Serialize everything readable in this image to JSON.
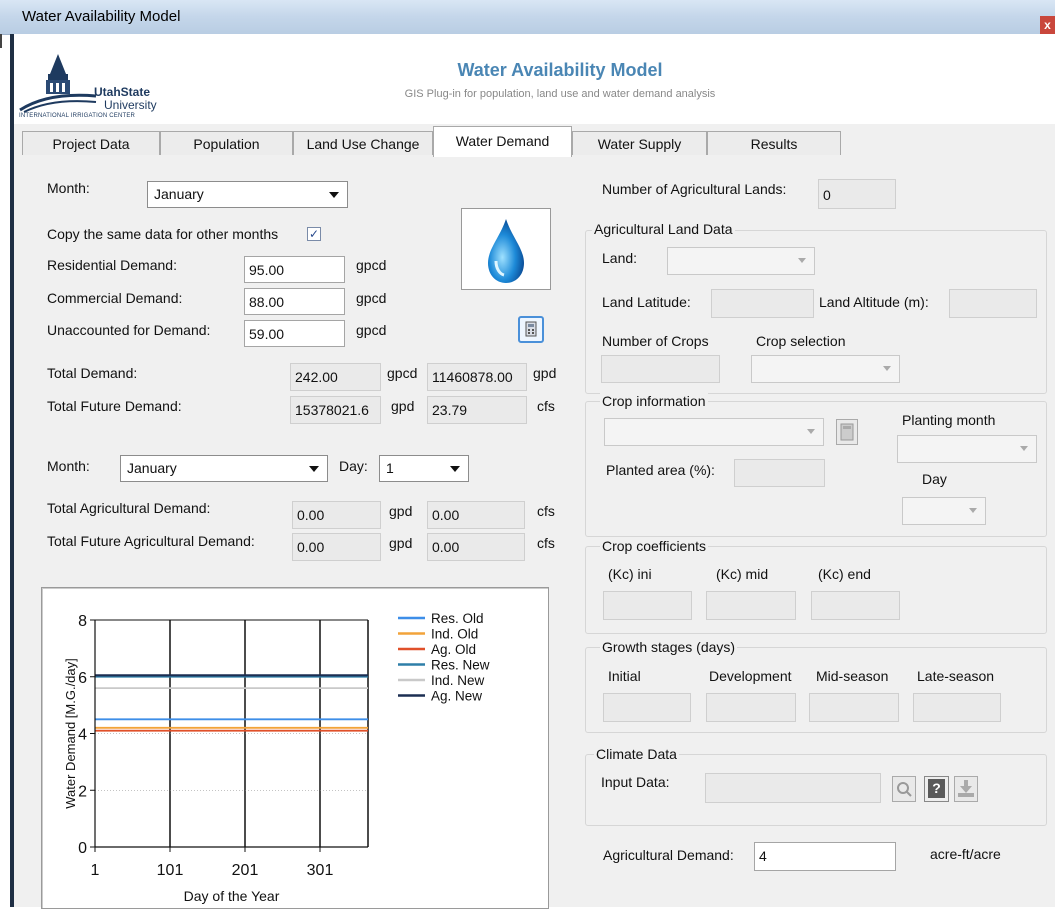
{
  "window": {
    "title": "Water Availability Model",
    "close_glyph": "x"
  },
  "header": {
    "logo_name": "UtahState",
    "logo_name2": "University",
    "logo_center": "INTERNATIONAL IRRIGATION CENTER",
    "title": "Water Availability  Model",
    "subtitle": "GIS Plug-in for population, land use and water demand analysis"
  },
  "tabs": [
    {
      "label": "Project Data"
    },
    {
      "label": "Population"
    },
    {
      "label": "Land Use Change"
    },
    {
      "label": "Water Demand"
    },
    {
      "label": "Water Supply"
    },
    {
      "label": "Results"
    }
  ],
  "active_tab": "Water Demand",
  "left": {
    "month_label": "Month:",
    "month_value": "January",
    "copy_label": "Copy the same data for other months",
    "copy_checked": "✓",
    "residential_label": "Residential Demand:",
    "residential_value": "95.00",
    "residential_unit": "gpcd",
    "commercial_label": "Commercial Demand:",
    "commercial_value": "88.00",
    "commercial_unit": "gpcd",
    "unaccounted_label": "Unaccounted for Demand:",
    "unaccounted_value": "59.00",
    "unaccounted_unit": "gpcd",
    "total_label": "Total Demand:",
    "total_value1": "242.00",
    "total_unit1": "gpcd",
    "total_value2": "11460878.00",
    "total_unit2": "gpd",
    "future_label": "Total Future Demand:",
    "future_value1": "15378021.6",
    "future_unit1": "gpd",
    "future_value2": "23.79",
    "future_unit2": "cfs",
    "month2_label": "Month:",
    "month2_value": "January",
    "day_label": "Day:",
    "day_value": "1",
    "ag_label": "Total Agricultural Demand:",
    "ag_value1": "0.00",
    "ag_unit1": "gpd",
    "ag_value2": "0.00",
    "ag_unit2": "cfs",
    "agf_label": "Total Future Agricultural Demand:",
    "agf_value1": "0.00",
    "agf_unit1": "gpd",
    "agf_value2": "0.00",
    "agf_unit2": "cfs"
  },
  "right": {
    "num_lands_label": "Number of Agricultural Lands:",
    "num_lands_value": "0",
    "ag_land_group": "Agricultural Land Data",
    "land_label": "Land:",
    "lat_label": "Land Latitude:",
    "alt_label": "Land Altitude (m):",
    "num_crops_label": "Number of Crops",
    "crop_sel_label": "Crop selection",
    "crop_info_group": "Crop information",
    "planting_month_label": "Planting month",
    "planted_area_label": "Planted area (%):",
    "day_label": "Day",
    "crop_coef_group": "Crop coefficients",
    "kc_ini": "(Kc) ini",
    "kc_mid": "(Kc) mid",
    "kc_end": "(Kc) end",
    "growth_group": "Growth stages (days)",
    "g_initial": "Initial",
    "g_dev": "Development",
    "g_mid": "Mid-season",
    "g_late": "Late-season",
    "climate_group": "Climate Data",
    "input_label": "Input Data:",
    "help_glyph": "?",
    "ag_demand_label": "Agricultural Demand:",
    "ag_demand_value": "4",
    "ag_demand_unit": "acre-ft/acre"
  },
  "chart_data": {
    "type": "line",
    "xlabel": "Day of the Year",
    "ylabel": "Water Demand [M.G./day]",
    "xlim": [
      1,
      365
    ],
    "ylim": [
      0,
      8
    ],
    "xticks": [
      1,
      101,
      201,
      301
    ],
    "yticks": [
      0,
      2,
      4,
      6,
      8
    ],
    "grid": "vertical",
    "legend_position": "right",
    "series": [
      {
        "name": "Res. Old",
        "color": "#3d8ee8",
        "values": [
          4.5,
          4.5
        ]
      },
      {
        "name": "Ind. Old",
        "color": "#f2a33a",
        "values": [
          4.2,
          4.2
        ]
      },
      {
        "name": "Ag. Old",
        "color": "#e0502a",
        "values": [
          4.1,
          4.1
        ]
      },
      {
        "name": "Res. New",
        "color": "#2e7fa8",
        "values": [
          6.0,
          6.0
        ]
      },
      {
        "name": "Ind. New",
        "color": "#c9c9c9",
        "values": [
          5.6,
          5.6
        ]
      },
      {
        "name": "Ag. New",
        "color": "#1c2e52",
        "values": [
          6.05,
          6.05
        ]
      }
    ],
    "x": [
      1,
      365
    ]
  }
}
